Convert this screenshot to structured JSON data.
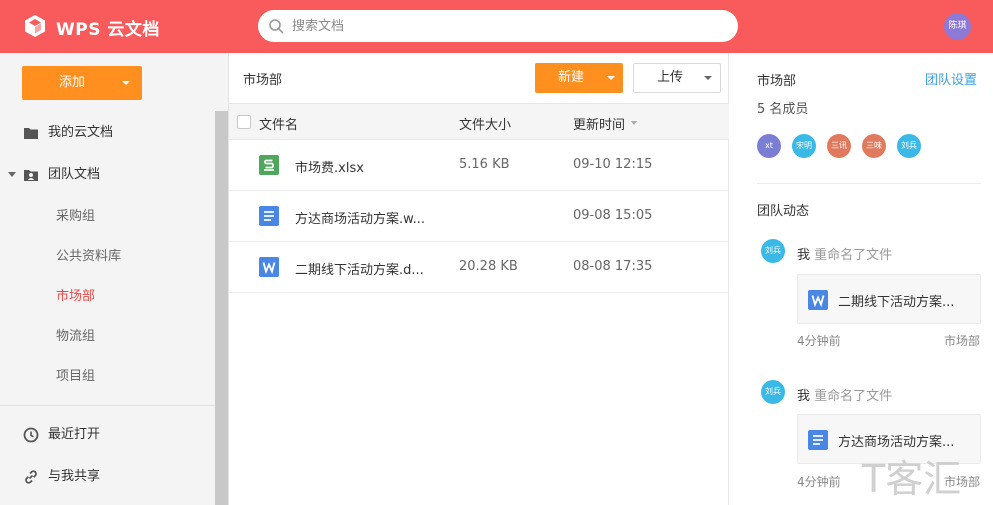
{
  "app": {
    "title": "WPS 云文档",
    "user_avatar": "陈琪"
  },
  "search": {
    "placeholder": "搜索文档",
    "value": ""
  },
  "sidebar": {
    "add_label": "添加",
    "items": [
      {
        "label": "我的云文档",
        "icon": "folder-icon"
      },
      {
        "label": "团队文档",
        "icon": "team-folder-icon"
      }
    ],
    "subitems": [
      "采购组",
      "公共资料库",
      "市场部",
      "物流组",
      "项目组"
    ],
    "active_subitem": "市场部",
    "bottom_items": [
      {
        "label": "最近打开",
        "icon": "clock-icon"
      },
      {
        "label": "与我共享",
        "icon": "link-icon"
      }
    ]
  },
  "main": {
    "title": "市场部",
    "new_label": "新建",
    "upload_label": "上传",
    "columns": [
      "文件名",
      "文件大小",
      "更新时间"
    ],
    "files": [
      {
        "name": "市场费.xlsx",
        "size": "5.16 KB",
        "time": "09-10 12:15",
        "type": "sheet"
      },
      {
        "name": "方达商场活动方案.w...",
        "size": "",
        "time": "09-08 15:05",
        "type": "doc"
      },
      {
        "name": "二期线下活动方案.d...",
        "size": "20.28 KB",
        "time": "08-08 17:35",
        "type": "word"
      }
    ]
  },
  "team": {
    "name": "市场部",
    "settings_label": "团队设置",
    "member_count": "5 名成员",
    "members": [
      {
        "initials": "xt",
        "color": "#7b7fd4"
      },
      {
        "initials": "宋明",
        "color": "#3ab8e6"
      },
      {
        "initials": "三讯",
        "color": "#e07a5f"
      },
      {
        "initials": "三味",
        "color": "#e07a5f"
      },
      {
        "initials": "刘兵",
        "color": "#3ab8e6"
      }
    ],
    "activity_title": "团队动态",
    "activities": [
      {
        "avatar": "刘兵",
        "who": "我",
        "action": "重命名了文件",
        "file": "二期线下活动方案...",
        "file_type": "word",
        "time": "4分钟前",
        "team": "市场部"
      },
      {
        "avatar": "刘兵",
        "who": "我",
        "action": "重命名了文件",
        "file": "方达商场活动方案...",
        "file_type": "doc",
        "time": "4分钟前",
        "team": "市场部"
      }
    ]
  },
  "watermark": "T客汇",
  "colors": {
    "header": "#f95b5c",
    "accent": "#ff8f1f",
    "active_nav": "#e84a4a",
    "link": "#3aa1e0"
  }
}
